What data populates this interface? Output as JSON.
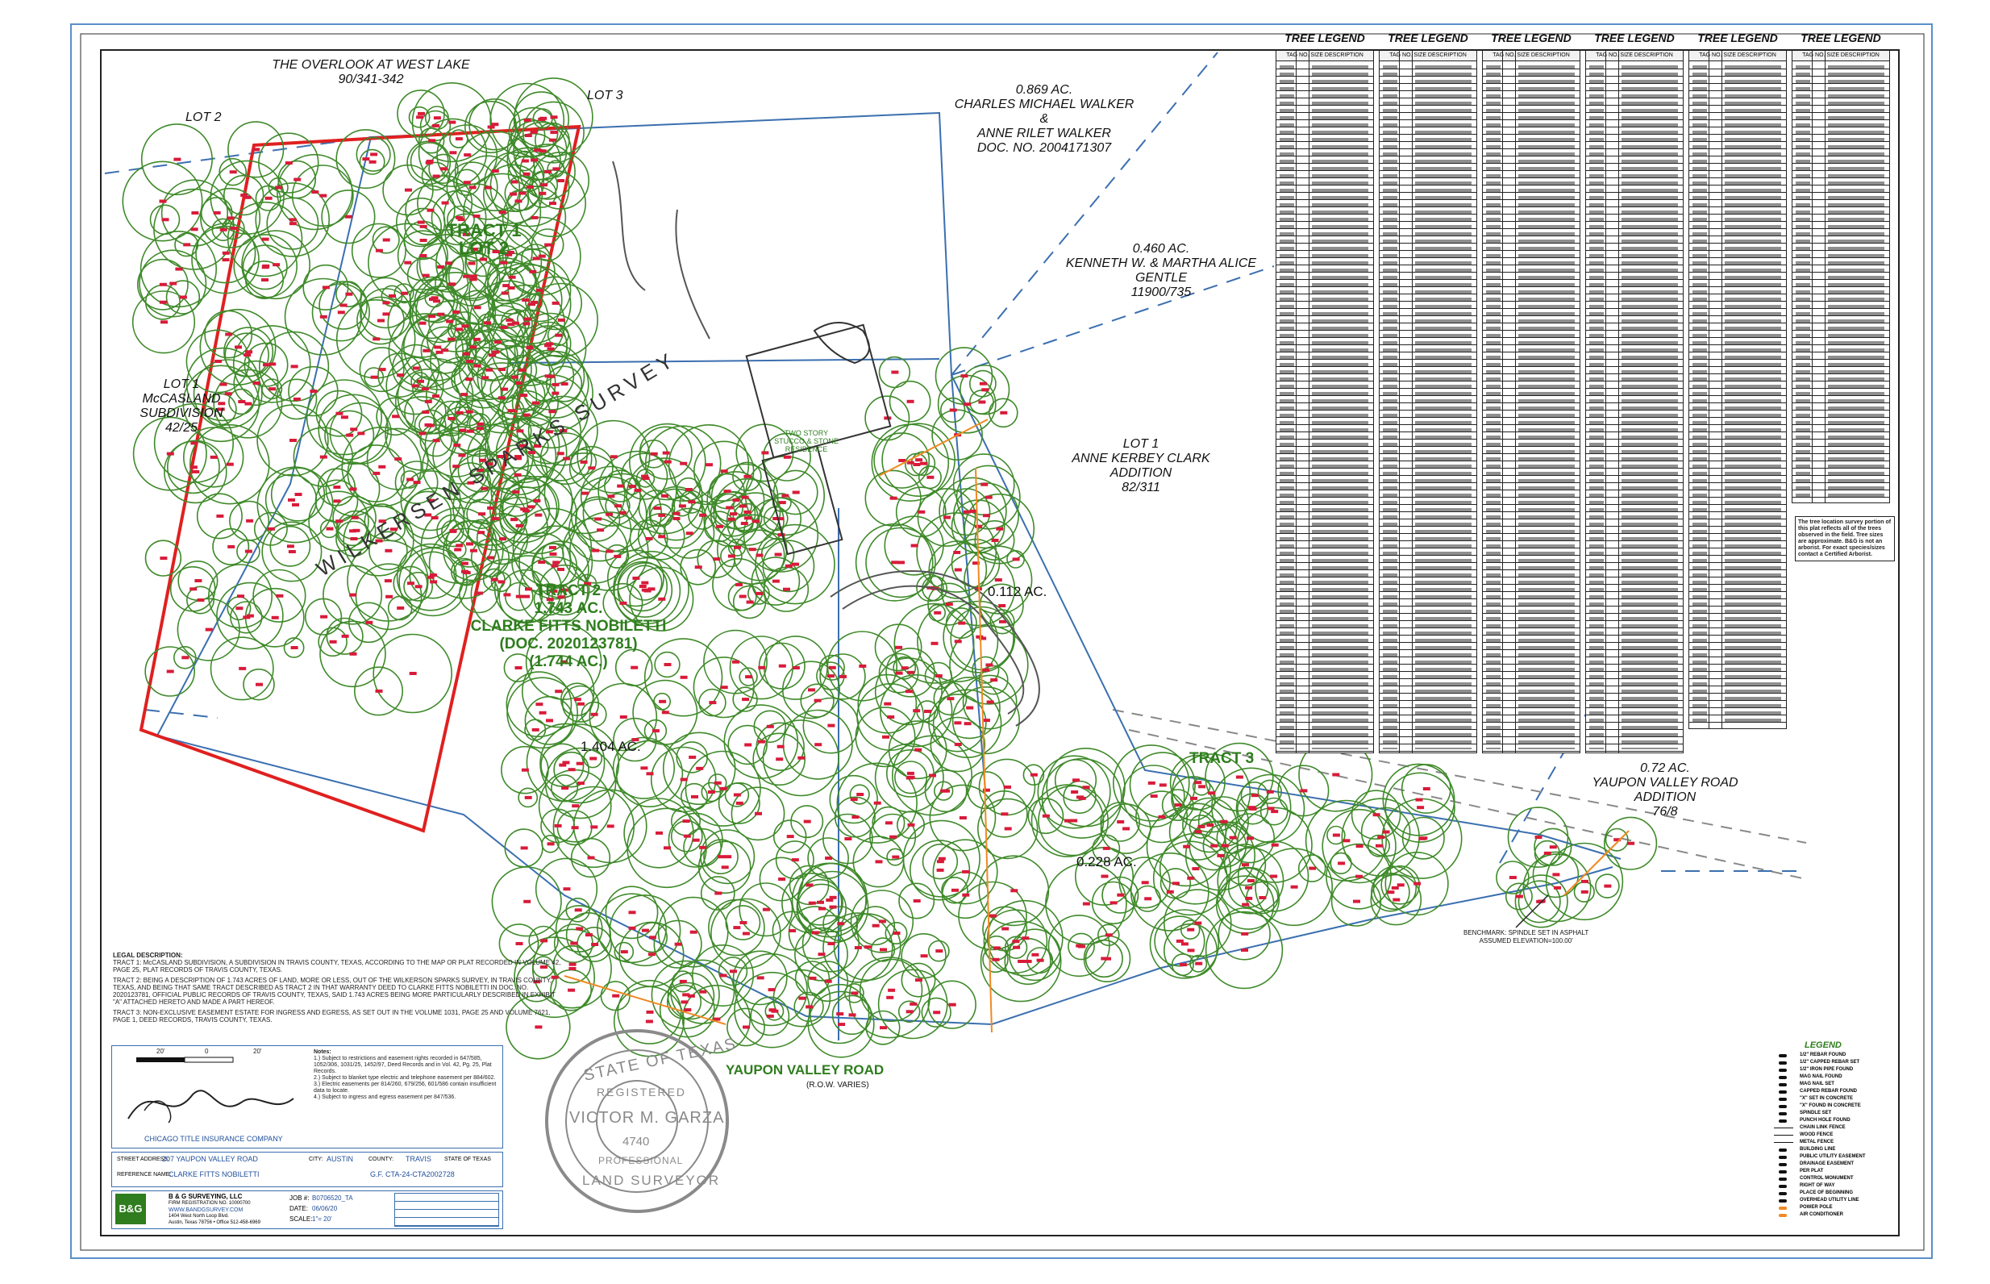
{
  "map": {
    "adjoiners": {
      "overlook": "THE OVERLOOK AT WEST LAKE\n90/341-342",
      "lot2": "LOT 2",
      "lot3": "LOT 3",
      "walker": "0.869 AC.\nCHARLES MICHAEL WALKER &\nANNE RILET WALKER\nDOC. NO. 2004171307",
      "gentle": "0.460 AC.\nKENNETH W. & MARTHA ALICE GENTLE\n11900/735",
      "mccasland": "LOT 1\nMcCASLAND SUBDIVISION\n42/25",
      "clark": "LOT 1\nANNE KERBEY CLARK ADDITION\n82/311",
      "yaupon_add": "0.72 AC.\nYAUPON VALLEY ROAD ADDITION\n76/8"
    },
    "tracts": {
      "tract1": "TRACT 1\nLOT 2",
      "tract2": "TRACT 2\n1.743 AC.\nCLARKE FITTS NOBILETTI\n(DOC. 2020123781)\n(1.744 AC.)",
      "tract3": "TRACT 3",
      "survey": "WILKERSEN SPARKS SURVEY",
      "acre_0112": "0.112 AC.",
      "acre_1404": "1.404 AC.",
      "acre_0228": "0.228 AC."
    },
    "road": {
      "name": "YAUPON VALLEY ROAD",
      "row": "(R.O.W. VARIES)"
    },
    "residence": "TWO STORY\nSTUCCO & STONE\nRESIDENCE",
    "benchmark": "BENCHMARK: SPINDLE SET IN ASPHALT\nASSUMED ELEVATION=100.00'"
  },
  "tree_legend": {
    "title": "TREE LEGEND",
    "columns": [
      "TREE LEGEND",
      "TREE LEGEND",
      "TREE LEGEND",
      "TREE LEGEND",
      "TREE LEGEND",
      "TREE LEGEND"
    ],
    "col_header": "TAG NO.  SIZE  DESCRIPTION"
  },
  "legal": {
    "heading": "LEGAL DESCRIPTION:",
    "tract1": "TRACT 1: McCASLAND SUBDIVISION, A SUBDIVISION IN TRAVIS COUNTY, TEXAS, ACCORDING TO THE MAP OR PLAT RECORDED IN VOLUME 42, PAGE 25, PLAT RECORDS OF TRAVIS COUNTY, TEXAS.",
    "tract2": "TRACT 2: BEING A DESCRIPTION OF 1.743 ACRES OF LAND, MORE OR LESS, OUT OF THE WILKERSON SPARKS SURVEY, IN TRAVIS COUNTY, TEXAS, AND BEING THAT SAME TRACT DESCRIBED AS TRACT 2 IN THAT WARRANTY DEED TO CLARKE FITTS NOBILETTI IN DOC. NO. 2020123781, OFFICIAL PUBLIC RECORDS OF TRAVIS COUNTY, TEXAS, SAID 1.743 ACRES BEING MORE PARTICULARLY DESCRIBED IN EXHIBIT \"A\" ATTACHED HERETO AND MADE A PART HEREOF.",
    "tract3": "TRACT 3: NON-EXCLUSIVE EASEMENT ESTATE FOR INGRESS AND EGRESS, AS SET OUT IN THE VOLUME 1031, PAGE 25 AND VOLUME 7621, PAGE 1, DEED RECORDS, TRAVIS COUNTY, TEXAS."
  },
  "notes": {
    "heading": "Notes:",
    "lines": [
      "1.) Subject to restrictions and easement rights recorded in 647/585, 1052/306, 1031/25, 1452/97, Deed Records and in Vol. 42, Pg. 25, Plat Records.",
      "2.) Subject to blanket type electric and telephone easement per 884/602.",
      "3.) Electric easements per 814/260, 679/256, 601/586 contain insufficient data to locate.",
      "4.) Subject to ingress and egress easement per 847/536."
    ]
  },
  "title_company": "CHICAGO TITLE INSURANCE COMPANY",
  "scale_bar": {
    "left": "20'",
    "mid": "0",
    "right": "20'"
  },
  "property": {
    "street_label": "STREET ADDRESS:",
    "street": "207 YAUPON VALLEY ROAD",
    "city_label": "CITY:",
    "city": "AUSTIN",
    "county_label": "COUNTY:",
    "county": "TRAVIS",
    "state_label": "STATE OF TEXAS",
    "ref_label": "REFERENCE NAME:",
    "ref": "CLARKE FITTS NOBILETTI",
    "gf": "G.F. CTA-24-CTA2002728"
  },
  "firm": {
    "name": "B & G SURVEYING, LLC",
    "line2": "FIRM REGISTRATION NO. 10000700",
    "web": "WWW.BANDGSURVEY.COM",
    "addr": "1404 West North Loop Blvd.",
    "city": "Austin, Texas 78756 • Office 512-458-6969",
    "job_label": "JOB #:",
    "job": "B0706520_TA",
    "date_label": "DATE:",
    "date": "06/06/20",
    "scale_label": "SCALE:",
    "scale": "1\"= 20'"
  },
  "seal": {
    "top": "STATE OF TEXAS",
    "registered": "REGISTERED",
    "name": "VICTOR M. GARZA",
    "number": "4740",
    "professional": "PROFESSIONAL",
    "bottom": "LAND SURVEYOR"
  },
  "legend": {
    "title": "LEGEND",
    "items": [
      "1/2\" REBAR FOUND",
      "1/2\" CAPPED REBAR SET",
      "1/2\" IRON PIPE FOUND",
      "MAG NAIL FOUND",
      "MAG NAIL SET",
      "CAPPED REBAR FOUND",
      "\"X\" SET IN CONCRETE",
      "\"X\" FOUND IN CONCRETE",
      "SPINDLE SET",
      "PUNCH HOLE FOUND",
      "CHAIN LINK FENCE",
      "WOOD FENCE",
      "METAL FENCE",
      "BUILDING LINE",
      "PUBLIC UTILITY EASEMENT",
      "DRAINAGE EASEMENT",
      "PER PLAT",
      "CONTROL MONUMENT",
      "RIGHT OF WAY",
      "PLACE OF BEGINNING",
      "OVERHEAD UTILITY LINE",
      "POWER POLE",
      "AIR CONDITIONER"
    ],
    "abbrev": [
      "B.L.",
      "P.U.E.",
      "D.E.",
      "( )",
      "C.M.",
      "R.O.W.",
      "P.O.B.",
      "OHU"
    ]
  },
  "legend_note": "The tree location survey portion of this plat reflects all of the trees observed in the field. Tree sizes are approximate. B&G is not an arborist. For exact species/sizes contact a Certified Arborist.",
  "colors": {
    "tract1_outline": "#e02020",
    "boundary": "#3b6fb0",
    "trees": "#3f8a2a",
    "tags": "#d81b3a",
    "easement": "#f08a24"
  }
}
